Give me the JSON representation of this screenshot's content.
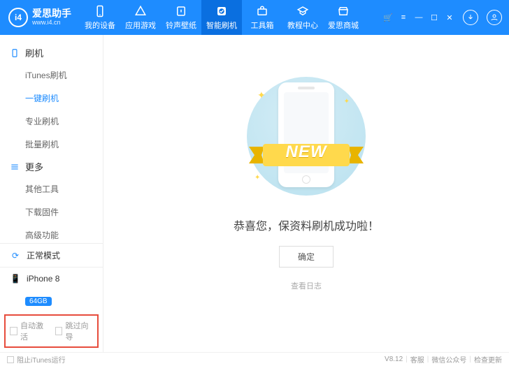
{
  "brand": {
    "title": "爱思助手",
    "subtitle": "www.i4.cn",
    "badge": "i4"
  },
  "nav": [
    {
      "label": "我的设备"
    },
    {
      "label": "应用游戏"
    },
    {
      "label": "铃声壁纸"
    },
    {
      "label": "智能刷机"
    },
    {
      "label": "工具箱"
    },
    {
      "label": "教程中心"
    },
    {
      "label": "爱思商城"
    }
  ],
  "sidebar": {
    "group1": {
      "title": "刷机",
      "items": [
        "iTunes刷机",
        "一键刷机",
        "专业刷机",
        "批量刷机"
      ],
      "activeIndex": 1
    },
    "group2": {
      "title": "更多",
      "items": [
        "其他工具",
        "下载固件",
        "高级功能"
      ]
    }
  },
  "device": {
    "mode": "正常模式",
    "name": "iPhone 8",
    "storage": "64GB"
  },
  "options": {
    "autoActivate": "自动激活",
    "skipGuide": "跳过向导"
  },
  "main": {
    "newBadge": "NEW",
    "message": "恭喜您，保资料刷机成功啦！",
    "confirm": "确定",
    "viewLog": "查看日志"
  },
  "status": {
    "blockItunes": "阻止iTunes运行",
    "version": "V8.12",
    "support": "客服",
    "wechat": "微信公众号",
    "update": "检查更新"
  }
}
